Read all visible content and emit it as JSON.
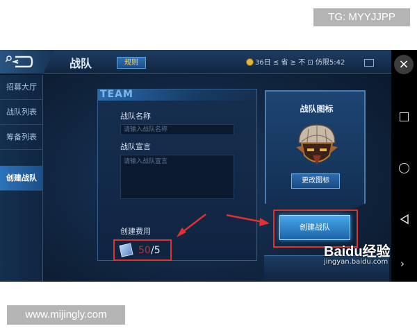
{
  "watermarks": {
    "top": "TG: MYYJJPP",
    "bottom": "www.mijingly.com"
  },
  "topbar": {
    "title": "战队",
    "rules_label": "规则",
    "status_text": "36日 ≤ 省 ≥ 不 ⊡ 仿限5:42"
  },
  "sidebar": {
    "items": [
      {
        "label": "招募大厅",
        "active": false
      },
      {
        "label": "战队列表",
        "active": false
      },
      {
        "label": "筹备列表",
        "active": false
      },
      {
        "label": "创建战队",
        "active": true
      }
    ]
  },
  "panel": {
    "header": "TEAM",
    "name_label": "战队名称",
    "name_placeholder": "请输入战队名称",
    "declaration_label": "战队宣言",
    "declaration_placeholder": "请输入战队宣言",
    "cost_label": "创建费用",
    "cost_current": "50",
    "cost_total": "/5"
  },
  "emblem_card": {
    "title": "战队图标",
    "change_label": "更改图标"
  },
  "create_button": "创建战队",
  "baidu": {
    "logo": "Baidu经验",
    "url": "jingyan.baidu.com"
  },
  "android_nav": {
    "close": "×",
    "next": "›"
  },
  "colors": {
    "highlight": "#e13030",
    "accent": "#3a92da"
  }
}
